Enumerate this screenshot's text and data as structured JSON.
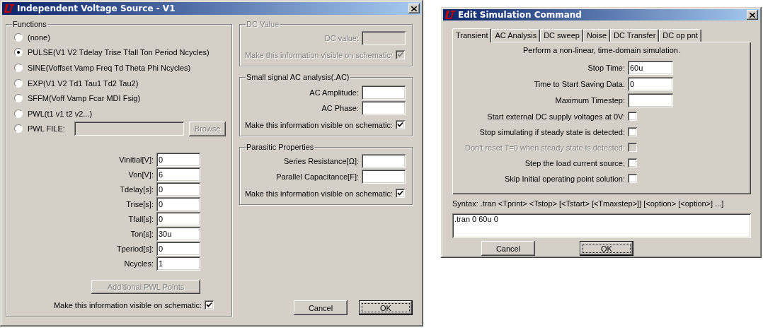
{
  "voltage_source_dialog": {
    "title": "Independent Voltage Source - V1",
    "functions": {
      "legend": "Functions",
      "options": [
        {
          "kind": "plain",
          "label": "(none)",
          "selected": false
        },
        {
          "kind": "plain",
          "label": "PULSE(V1 V2 Tdelay Trise Tfall Ton Period Ncycles)",
          "selected": true
        },
        {
          "kind": "plain",
          "label": "SINE(Voffset Vamp Freq Td Theta Phi Ncycles)",
          "selected": false
        },
        {
          "kind": "plain",
          "label": "EXP(V1 V2 Td1 Tau1 Td2 Tau2)",
          "selected": false
        },
        {
          "kind": "plain",
          "label": "SFFM(Voff Vamp Fcar MDI Fsig)",
          "selected": false
        },
        {
          "kind": "plain",
          "label": "PWL(t1 v1 t2 v2...)",
          "selected": false
        },
        {
          "kind": "file",
          "label": "PWL FILE:",
          "selected": false,
          "browse": {
            "label": "Browse",
            "disabled": true
          }
        }
      ],
      "parameters": [
        {
          "label": "Vinitial[V]:",
          "value": "0"
        },
        {
          "label": "Von[V]:",
          "value": "6"
        },
        {
          "label": "Tdelay[s]:",
          "value": "0"
        },
        {
          "label": "Trise[s]:",
          "value": "0"
        },
        {
          "label": "Tfall[s]:",
          "value": "0"
        },
        {
          "label": "Ton[s]:",
          "value": "30u"
        },
        {
          "label": "Tperiod[s]:",
          "value": "0"
        },
        {
          "label": "Ncycles:",
          "value": "1"
        }
      ],
      "additional_button": {
        "label": "Additional PWL Points",
        "disabled": true
      },
      "visible": {
        "label": "Make this information visible on schematic:",
        "checked": true,
        "disabled": false
      }
    },
    "groups": [
      {
        "legend": "DC Value",
        "disabled": true,
        "fields": [
          {
            "label": "DC value:"
          }
        ],
        "visible": {
          "label": "Make this information visible on schematic:",
          "checked": true,
          "disabled": true
        }
      },
      {
        "legend": "Small signal AC analysis(.AC)",
        "disabled": false,
        "fields": [
          {
            "label": "AC Amplitude:"
          },
          {
            "label": "AC Phase:"
          }
        ],
        "visible": {
          "label": "Make this information visible on schematic:",
          "checked": true,
          "disabled": false
        }
      },
      {
        "legend": "Parasitic Properties",
        "disabled": false,
        "fields": [
          {
            "label": "Series Resistance[Ω]:"
          },
          {
            "label": "Parallel Capacitance[F]:"
          }
        ],
        "visible": {
          "label": "Make this information visible on schematic:",
          "checked": true,
          "disabled": false
        }
      }
    ],
    "buttons": [
      {
        "label": "Cancel",
        "default": false
      },
      {
        "label": "OK",
        "default": true
      }
    ]
  },
  "simulation_dialog": {
    "title": "Edit Simulation Command",
    "tabs": [
      {
        "label": "Transient",
        "selected": true
      },
      {
        "label": "AC Analysis",
        "selected": false
      },
      {
        "label": "DC sweep",
        "selected": false
      },
      {
        "label": "Noise",
        "selected": false
      },
      {
        "label": "DC Transfer",
        "selected": false
      },
      {
        "label": "DC op pnt",
        "selected": false
      }
    ],
    "description": "Perform a non-linear, time-domain simulation.",
    "fields": [
      {
        "label": "Stop Time:",
        "value": "60u"
      },
      {
        "label": "Time to Start Saving Data:",
        "value": "0"
      },
      {
        "label": "Maximum Timestep:"
      }
    ],
    "options": [
      {
        "label": "Start external DC supply voltages at 0V:",
        "checked": false,
        "disabled": false
      },
      {
        "label": "Stop simulating if steady state is detected:",
        "checked": false,
        "disabled": false
      },
      {
        "label": "Don't reset T=0 when steady state is detected:",
        "checked": false,
        "disabled": true
      },
      {
        "label": "Step the load current source:",
        "checked": false,
        "disabled": false
      },
      {
        "label": "Skip Initial operating point solution:",
        "checked": false,
        "disabled": false
      }
    ],
    "syntax": "Syntax:  .tran <Tprint> <Tstop> [<Tstart> [<Tmaxstep>]] [<option> [<option>] ...]",
    "command": ".tran 0 60u 0",
    "buttons": [
      {
        "label": "Cancel",
        "default": false
      },
      {
        "label": "OK",
        "default": true
      }
    ]
  }
}
